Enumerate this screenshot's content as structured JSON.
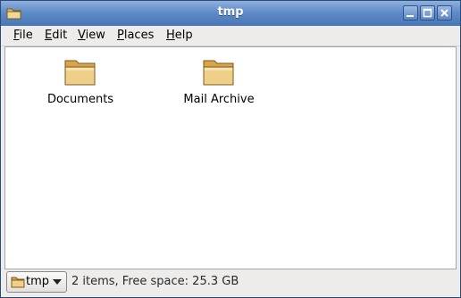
{
  "window": {
    "title": "tmp"
  },
  "menubar": {
    "items": [
      {
        "label": "File",
        "mnemonic": "F",
        "rest": "ile"
      },
      {
        "label": "Edit",
        "mnemonic": "E",
        "rest": "dit"
      },
      {
        "label": "View",
        "mnemonic": "V",
        "rest": "iew"
      },
      {
        "label": "Places",
        "mnemonic": "P",
        "rest": "laces"
      },
      {
        "label": "Help",
        "mnemonic": "H",
        "rest": "elp"
      }
    ]
  },
  "files": [
    {
      "name": "Documents",
      "icon": "folder-icon"
    },
    {
      "name": "Mail Archive",
      "icon": "folder-icon"
    }
  ],
  "statusbar": {
    "location": "tmp",
    "status": "2 items, Free space: 25.3 GB"
  },
  "colors": {
    "titlebar": "#5f8cc8",
    "folder": "#e2b766",
    "background": "#edeceb"
  }
}
